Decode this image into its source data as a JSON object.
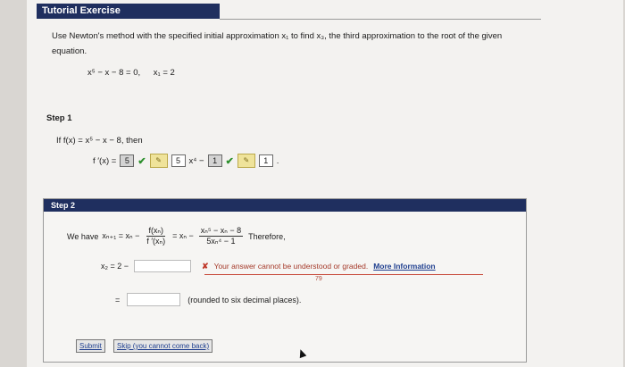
{
  "tutorial": {
    "title": "Tutorial Exercise"
  },
  "problem": {
    "text": "Use Newton's method with the specified initial approximation x₁ to find x₃, the third approximation to the root of the given equation.",
    "equation": "x⁵ − x − 8 = 0,",
    "initial": "x₁ = 2"
  },
  "step1": {
    "label": "Step 1",
    "text": "If f(x) = x⁵ − x − 8, then",
    "derivative_prefix": "f ′(x) =",
    "answer1": "5",
    "answer2": "5",
    "power": "x⁴ −",
    "answer3": "1",
    "answer4": "1",
    "suffix": "."
  },
  "step2": {
    "label": "Step 2",
    "we_have": "We have",
    "lhs": "xₙ₊₁ = xₙ −",
    "frac1_num": "f(xₙ)",
    "frac1_den": "f ′(xₙ)",
    "eq2": "= xₙ −",
    "frac2_num": "xₙ⁵ − xₙ − 8",
    "frac2_den": "5xₙ⁴ − 1",
    "therefore": "Therefore,",
    "x2_label": "x₂ = 2 −",
    "feedback_text": "Your answer cannot be understood or graded.",
    "more_info": "More Information",
    "small_number": "79",
    "equals": "=",
    "rounded_note": "(rounded to six decimal places)."
  },
  "buttons": {
    "submit": "Submit",
    "skip": "Skip (you cannot come back)"
  }
}
